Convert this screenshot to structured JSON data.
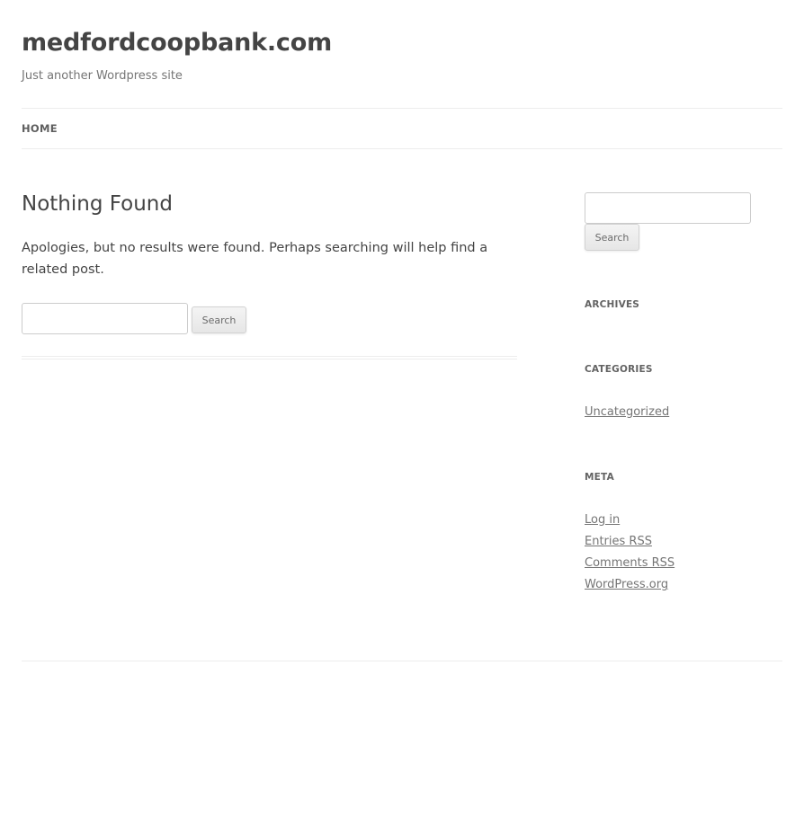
{
  "header": {
    "site_title": "medfordcoopbank.com",
    "tagline": "Just another Wordpress site"
  },
  "nav": {
    "home": "HOME"
  },
  "main": {
    "title": "Nothing Found",
    "message": "Apologies, but no results were found. Perhaps searching will help find a related post.",
    "search": {
      "value": "",
      "button_label": "Search"
    }
  },
  "sidebar": {
    "search": {
      "value": "",
      "button_label": "Search"
    },
    "archives_title": "ARCHIVES",
    "categories_title": "CATEGORIES",
    "categories": [
      "Uncategorized"
    ],
    "meta_title": "META",
    "meta_links": [
      "Log in",
      "Entries RSS",
      "Comments RSS",
      "WordPress.org"
    ]
  },
  "colors": {
    "text": "#444444",
    "muted": "#757575",
    "rule": "#ededed"
  }
}
